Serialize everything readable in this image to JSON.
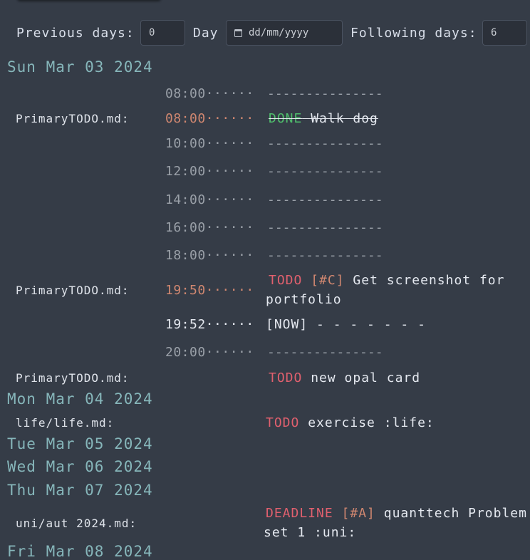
{
  "controls": {
    "previous_days_label": "Previous days:",
    "previous_days_value": "0",
    "day_label": "Day",
    "day_placeholder": "dd/mm/yyyy",
    "following_days_label": "Following days:",
    "following_days_value": "6"
  },
  "days": [
    {
      "header": "Sun Mar 03 2024"
    },
    {
      "header": "Mon Mar 04 2024"
    },
    {
      "header": "Tue Mar 05 2024"
    },
    {
      "header": "Wed Mar 06 2024"
    },
    {
      "header": "Thu Mar 07 2024"
    },
    {
      "header": "Fri Mar 08 2024"
    }
  ],
  "sun": {
    "grid_times": [
      "08:00······",
      "10:00······",
      "12:00······",
      "14:00······",
      "16:00······",
      "18:00······",
      "20:00······"
    ],
    "grid_line": "---------------",
    "walk_dog": {
      "file": "PrimaryTODO.md:",
      "time": "08:00······",
      "keyword": "DONE",
      "text": " Walk dog"
    },
    "screenshot": {
      "file": "PrimaryTODO.md:",
      "time": "19:50······",
      "keyword": "TODO",
      "priority": "[#C]",
      "text": "Get screenshot for portfolio"
    },
    "now": {
      "time": "19:52······",
      "text": "[NOW] - - - - - - -"
    },
    "opal": {
      "file": "PrimaryTODO.md:",
      "keyword": "TODO",
      "text": "new opal card"
    }
  },
  "mon": {
    "exercise": {
      "file": "life/life.md:",
      "keyword": "TODO",
      "text": "exercise :life:"
    }
  },
  "thu": {
    "quanttech": {
      "file": "uni/aut 2024.md:",
      "keyword": "DEADLINE",
      "priority": "[#A]",
      "text": "quanttech Problem set 1 :uni:"
    }
  },
  "colors": {
    "background": "#353c47",
    "date_header": "#86b6ba",
    "todo": "#e0606e",
    "done": "#4fbe6c",
    "priority": "#d08770",
    "muted": "#9aa0a8"
  }
}
